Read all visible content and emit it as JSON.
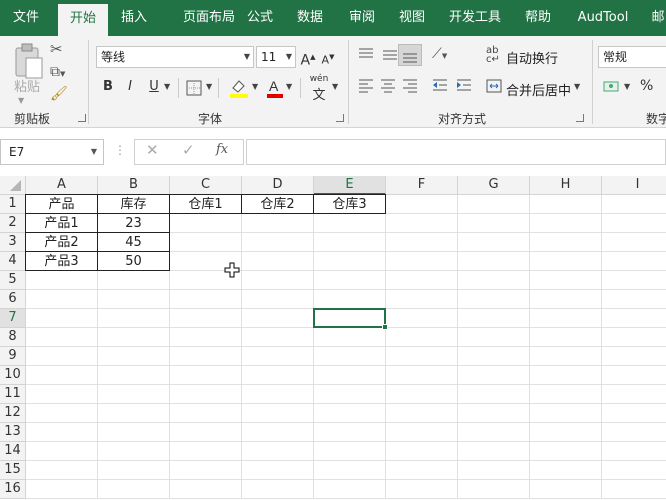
{
  "menu": {
    "tabs": [
      "文件",
      "开始",
      "插入",
      "页面布局",
      "公式",
      "数据",
      "审阅",
      "视图",
      "开发工具",
      "帮助",
      "AudTool",
      "邮"
    ],
    "active_index": 1
  },
  "ribbon": {
    "clipboard": {
      "paste_label": "粘贴",
      "group_label": "剪贴板"
    },
    "font": {
      "font_name": "等线",
      "font_size": "11",
      "bold": "B",
      "italic": "I",
      "underline": "U",
      "grow": "A",
      "shrink": "A",
      "group_label": "字体",
      "phonetic": "wén"
    },
    "alignment": {
      "wrap_text": "自动换行",
      "merge_center": "合并后居中",
      "group_label": "对齐方式"
    },
    "number": {
      "format": "常规",
      "percent": "%",
      "group_label": "数字"
    }
  },
  "formula_bar": {
    "name_box": "E7",
    "fx": "fx",
    "value": ""
  },
  "sheet": {
    "columns": [
      "A",
      "B",
      "C",
      "D",
      "E",
      "F",
      "G",
      "H",
      "I"
    ],
    "selected_column": "E",
    "rows": [
      "1",
      "2",
      "3",
      "4",
      "5",
      "6",
      "7",
      "8",
      "9",
      "10",
      "11",
      "12",
      "13",
      "14",
      "15",
      "16"
    ],
    "selected_row": "7",
    "cells": [
      [
        "产品",
        "库存",
        "仓库1",
        "仓库2",
        "仓库3"
      ],
      [
        "产品1",
        "23"
      ],
      [
        "产品2",
        "45"
      ],
      [
        "产品3",
        "50"
      ]
    ],
    "active_cell": "E7"
  },
  "colors": {
    "accent": "#217346",
    "ribbon_bg": "#f3f3f3",
    "header_bg": "#f3f3f3"
  }
}
